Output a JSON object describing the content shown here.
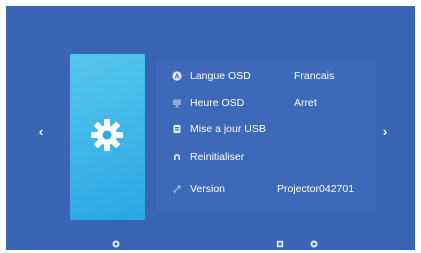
{
  "menu": {
    "items": [
      {
        "label": "Langue OSD",
        "value": "Francais",
        "icon": "language-icon"
      },
      {
        "label": "Heure OSD",
        "value": "Arret",
        "icon": "display-time-icon"
      },
      {
        "label": "Mise a jour USB",
        "value": "",
        "icon": "usb-update-icon"
      },
      {
        "label": "Reinitialiser",
        "value": "",
        "icon": "reset-icon"
      },
      {
        "label": "Version",
        "value": "Projector042701",
        "icon": "version-icon"
      }
    ]
  },
  "nav": {
    "prev": "‹",
    "next": "›"
  },
  "category_icon": "gear-icon",
  "colors": {
    "background": "#3a64b4",
    "card": "#3bb4e9",
    "text": "#ffffff"
  }
}
